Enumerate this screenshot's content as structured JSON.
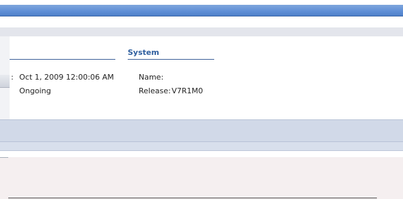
{
  "sections": {
    "left_heading": "",
    "system_heading": "System"
  },
  "details": {
    "colon_prefix": ":",
    "date_value": "Oct 1, 2009 12:00:06 AM",
    "status_value": "Ongoing",
    "name_label": "Name:",
    "name_value": "",
    "release_label": "Release:",
    "release_value": "V7R1M0"
  },
  "colors": {
    "title_bar": "#5e8ed6",
    "section_heading": "#2f5f9f",
    "band": "#d1d9e8"
  }
}
